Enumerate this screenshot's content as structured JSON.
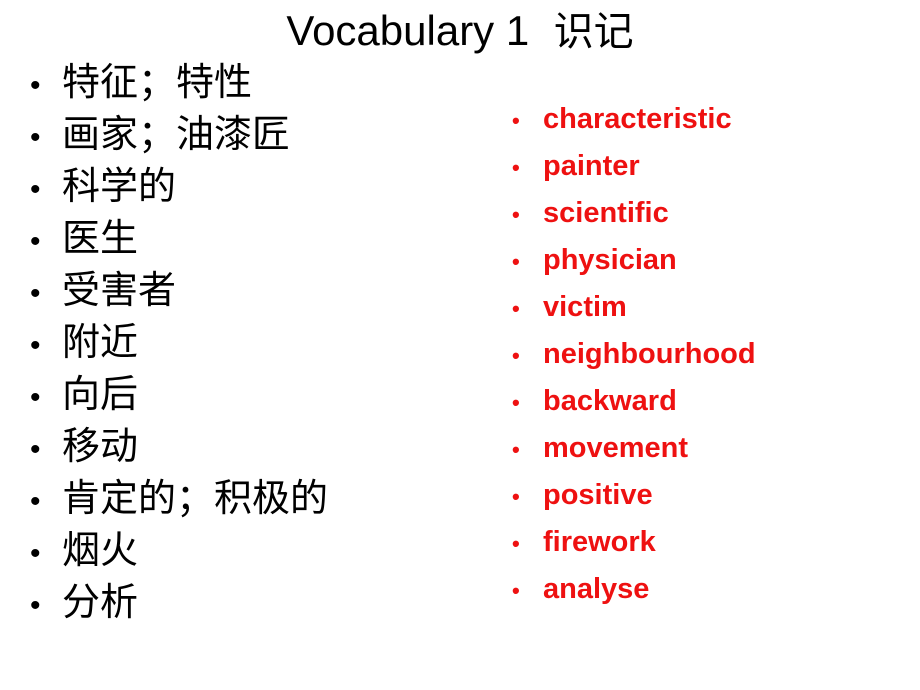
{
  "slide": {
    "title_latin": "Vocabulary 1 ",
    "title_cjk": " 识记",
    "background_color": "#FFFFFF",
    "text_color": "#000000",
    "accent_color": "#EE1111",
    "bullet_glyph": "•"
  },
  "left_column": {
    "language": "chinese",
    "color": "#000000",
    "items": [
      {
        "label": "特征；特性"
      },
      {
        "label": "画家；油漆匠"
      },
      {
        "label": "科学的"
      },
      {
        "label": "医生"
      },
      {
        "label": "受害者"
      },
      {
        "label": "附近"
      },
      {
        "label": "向后"
      },
      {
        "label": "移动"
      },
      {
        "label": "肯定的；积极的"
      },
      {
        "label": "烟火"
      },
      {
        "label": "分析"
      }
    ]
  },
  "right_column": {
    "language": "english",
    "color": "#EE1111",
    "items": [
      {
        "label": "characteristic"
      },
      {
        "label": "painter"
      },
      {
        "label": "scientific"
      },
      {
        "label": "physician"
      },
      {
        "label": "victim"
      },
      {
        "label": "neighbourhood"
      },
      {
        "label": "backward"
      },
      {
        "label": "movement"
      },
      {
        "label": "positive"
      },
      {
        "label": "firework"
      },
      {
        "label": "analyse"
      }
    ]
  }
}
